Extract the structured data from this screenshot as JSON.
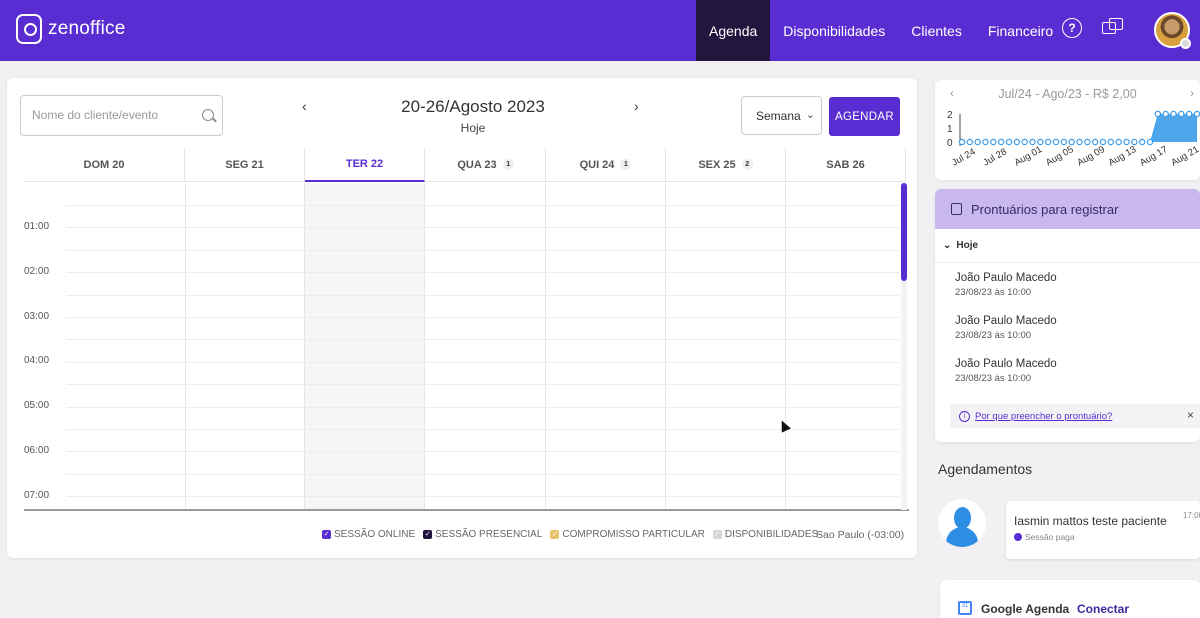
{
  "app": {
    "logo": "zenoffice"
  },
  "nav": {
    "items": [
      "Agenda",
      "Disponibilidades",
      "Clientes",
      "Financeiro"
    ],
    "active": 0
  },
  "calendar": {
    "search_placeholder": "Nome do cliente/evento",
    "title": "20-26/Agosto 2023",
    "subtitle": "Hoje",
    "prev": "‹",
    "next": "›",
    "view": "Semana",
    "agendar": "AGENDAR",
    "days": [
      {
        "label": "DOM 20",
        "badge": ""
      },
      {
        "label": "SEG 21",
        "badge": ""
      },
      {
        "label": "TER 22",
        "badge": ""
      },
      {
        "label": "QUA 23",
        "badge": "1"
      },
      {
        "label": "QUI 24",
        "badge": "1"
      },
      {
        "label": "SEX 25",
        "badge": "2"
      },
      {
        "label": "SAB 26",
        "badge": ""
      }
    ],
    "today_index": 2,
    "hours": [
      "01:00",
      "02:00",
      "03:00",
      "04:00",
      "05:00",
      "06:00",
      "07:00"
    ],
    "legend": [
      {
        "label": "SESSÃO ONLINE",
        "color": "#5a2dd2"
      },
      {
        "label": "SESSÃO PRESENCIAL",
        "color": "#22153e"
      },
      {
        "label": "COMPROMISSO PARTICULAR",
        "color": "#e8c56a"
      },
      {
        "label": "DISPONIBILIDADES",
        "color": "#d6d6d6"
      }
    ],
    "timezone": "Sao Paulo (-03:00)"
  },
  "revenue": {
    "title": "Jul/24 - Ago/23 - R$ 2,00",
    "prev": "‹",
    "next": "›"
  },
  "chart_data": {
    "type": "area",
    "categories": [
      "Jul 24",
      "Jul 25",
      "Jul 26",
      "Jul 27",
      "Jul 28",
      "Jul 29",
      "Jul 30",
      "Jul 31",
      "Aug 01",
      "Aug 02",
      "Aug 03",
      "Aug 04",
      "Aug 05",
      "Aug 06",
      "Aug 07",
      "Aug 08",
      "Aug 09",
      "Aug 10",
      "Aug 11",
      "Aug 12",
      "Aug 13",
      "Aug 14",
      "Aug 15",
      "Aug 16",
      "Aug 17",
      "Aug 18",
      "Aug 19",
      "Aug 20",
      "Aug 21",
      "Aug 22",
      "Aug 23"
    ],
    "tick_labels": [
      "Jul 24",
      "Jul 28",
      "Aug 01",
      "Aug 05",
      "Aug 09",
      "Aug 13",
      "Aug 17",
      "Aug 21"
    ],
    "values": [
      0,
      0,
      0,
      0,
      0,
      0,
      0,
      0,
      0,
      0,
      0,
      0,
      0,
      0,
      0,
      0,
      0,
      0,
      0,
      0,
      0,
      0,
      0,
      0,
      0,
      2,
      2,
      2,
      2,
      2,
      2
    ],
    "yticks": [
      0,
      1,
      2
    ],
    "ylim": [
      0,
      2
    ],
    "color": "#3a9be8"
  },
  "prontuarios": {
    "title": "Prontuários para registrar",
    "group": "Hoje",
    "items": [
      {
        "name": "João Paulo Macedo",
        "date": "23/08/23 às 10:00"
      },
      {
        "name": "João Paulo Macedo",
        "date": "23/08/23 às 10:00"
      },
      {
        "name": "João Paulo Macedo",
        "date": "23/08/23 às 10:00"
      }
    ],
    "why_link": "Por que preencher o prontuário?",
    "close": "×"
  },
  "agendamentos": {
    "title": "Agendamentos",
    "item": {
      "name": "Iasmin mattos teste paciente",
      "time": "17:00",
      "status": "Sessão paga"
    }
  },
  "google": {
    "name": "Google Agenda",
    "link": "Conectar",
    "icon_text": "31"
  }
}
